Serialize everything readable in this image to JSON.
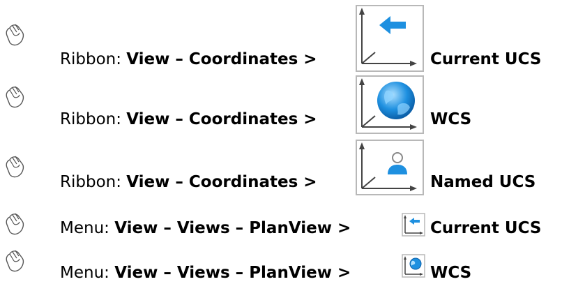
{
  "rows": [
    {
      "prefix": "Ribbon: ",
      "path": "View – Coordinates > ",
      "command": "Current UCS",
      "icon": "ucs-current-large-icon"
    },
    {
      "prefix": "Ribbon: ",
      "path": "View – Coordinates > ",
      "command": "WCS",
      "icon": "wcs-globe-large-icon"
    },
    {
      "prefix": "Ribbon: ",
      "path": "View – Coordinates > ",
      "command": "Named UCS",
      "icon": "named-ucs-large-icon"
    },
    {
      "prefix": "Menu: ",
      "path": "View – Views – PlanView > ",
      "command": "Current UCS",
      "icon": "ucs-current-small-icon"
    },
    {
      "prefix": "Menu: ",
      "path": "View – Views – PlanView > ",
      "command": "WCS",
      "icon": "wcs-globe-small-icon"
    }
  ],
  "colors": {
    "accent": "#1e90e0",
    "icon_border": "#b8b8b8",
    "axis": "#444444"
  }
}
